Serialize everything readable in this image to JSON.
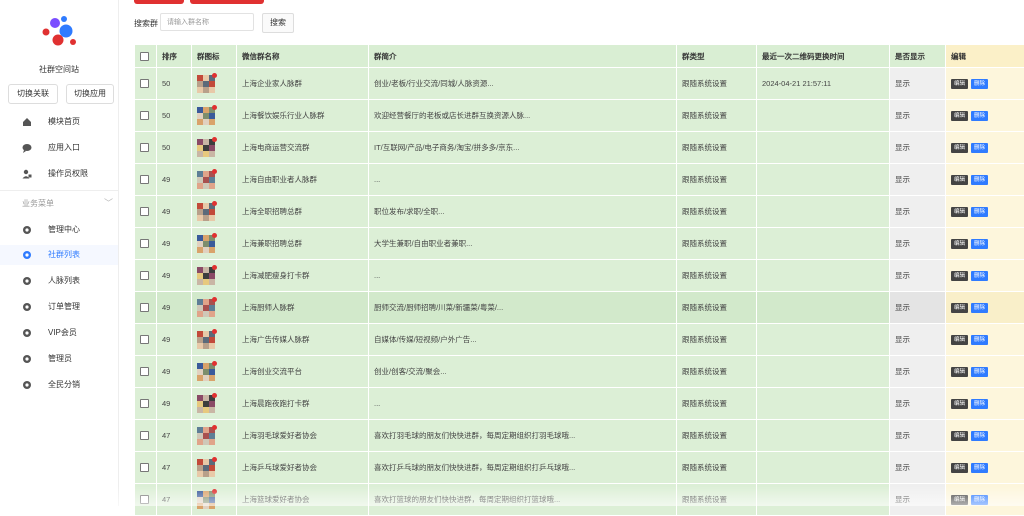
{
  "sidebar": {
    "site_title": "社群空间站",
    "switch_link": "切换关联",
    "switch_app": "切换应用",
    "top_items": [
      {
        "label": "模块首页",
        "icon": "home-icon"
      },
      {
        "label": "应用入口",
        "icon": "chat-icon"
      },
      {
        "label": "操作员权限",
        "icon": "user-lock-icon"
      }
    ],
    "section_label": "业务菜单",
    "items": [
      {
        "label": "管理中心",
        "icon": "gear-icon",
        "active": false
      },
      {
        "label": "社群列表",
        "icon": "gear-icon",
        "active": true
      },
      {
        "label": "人脉列表",
        "icon": "gear-icon",
        "active": false
      },
      {
        "label": "订单管理",
        "icon": "gear-icon",
        "active": false
      },
      {
        "label": "VIP会员",
        "icon": "gear-icon",
        "active": false
      },
      {
        "label": "管理员",
        "icon": "gear-icon",
        "active": false
      },
      {
        "label": "全民分销",
        "icon": "gear-icon",
        "active": false
      }
    ]
  },
  "search": {
    "label": "搜索群",
    "placeholder": "请输入群名称",
    "button": "搜索"
  },
  "table": {
    "headers": [
      "排序",
      "群图标",
      "微信群名称",
      "群简介",
      "群类型",
      "最近一次二维码更换时间",
      "是否显示",
      "编辑"
    ],
    "edit_label": "编辑",
    "delete_label": "删除",
    "rows": [
      {
        "sort": "50",
        "name": "上海企业家人脉群",
        "intro": "创业/老板/行业交流/同城/人脉资源...",
        "type": "跟随系统设置",
        "qr_time": "2024-04-21 21:57:11",
        "show": "显示"
      },
      {
        "sort": "50",
        "name": "上海餐饮娱乐行业人脉群",
        "intro": "欢迎经营餐厅的老板或店长进群互换资源人脉...",
        "type": "跟随系统设置",
        "qr_time": "",
        "show": "显示"
      },
      {
        "sort": "50",
        "name": "上海电商运营交流群",
        "intro": "IT/互联网/产品/电子商务/淘宝/拼多多/京东...",
        "type": "跟随系统设置",
        "qr_time": "",
        "show": "显示"
      },
      {
        "sort": "49",
        "name": "上海自由职业者人脉群",
        "intro": "...",
        "type": "跟随系统设置",
        "qr_time": "",
        "show": "显示"
      },
      {
        "sort": "49",
        "name": "上海全职招聘总群",
        "intro": "职位发布/求职/全职...",
        "type": "跟随系统设置",
        "qr_time": "",
        "show": "显示"
      },
      {
        "sort": "49",
        "name": "上海兼职招聘总群",
        "intro": "大学生兼职/自由职业者兼职...",
        "type": "跟随系统设置",
        "qr_time": "",
        "show": "显示"
      },
      {
        "sort": "49",
        "name": "上海减肥瘦身打卡群",
        "intro": "...",
        "type": "跟随系统设置",
        "qr_time": "",
        "show": "显示"
      },
      {
        "sort": "49",
        "name": "上海厨师人脉群",
        "intro": "厨师交流/厨师招聘/川菜/新疆菜/粤菜/...",
        "type": "跟随系统设置",
        "qr_time": "",
        "show": "显示"
      },
      {
        "sort": "49",
        "name": "上海广告传媒人脉群",
        "intro": "自媒体/传媒/短视频/户外广告...",
        "type": "跟随系统设置",
        "qr_time": "",
        "show": "显示"
      },
      {
        "sort": "49",
        "name": "上海创业交流平台",
        "intro": "创业/创客/交流/聚会...",
        "type": "跟随系统设置",
        "qr_time": "",
        "show": "显示"
      },
      {
        "sort": "49",
        "name": "上海晨跑夜跑打卡群",
        "intro": "...",
        "type": "跟随系统设置",
        "qr_time": "",
        "show": "显示"
      },
      {
        "sort": "47",
        "name": "上海羽毛球爱好者协会",
        "intro": "喜欢打羽毛球的朋友们快快进群，每周定期组织打羽毛球哦...",
        "type": "跟随系统设置",
        "qr_time": "",
        "show": "显示"
      },
      {
        "sort": "47",
        "name": "上海乒乓球爱好者协会",
        "intro": "喜欢打乒乓球的朋友们快快进群，每周定期组织打乒乓球哦...",
        "type": "跟随系统设置",
        "qr_time": "",
        "show": "显示"
      },
      {
        "sort": "47",
        "name": "上海篮球爱好者协会",
        "intro": "喜欢打篮球的朋友们快快进群，每周定期组织打篮球哦...",
        "type": "跟随系统设置",
        "qr_time": "",
        "show": "显示"
      }
    ]
  },
  "colors": {
    "accent": "#2f7bff",
    "danger": "#e03131",
    "row_green": "#dcefd6",
    "edit_bg": "#fdf6dc"
  }
}
